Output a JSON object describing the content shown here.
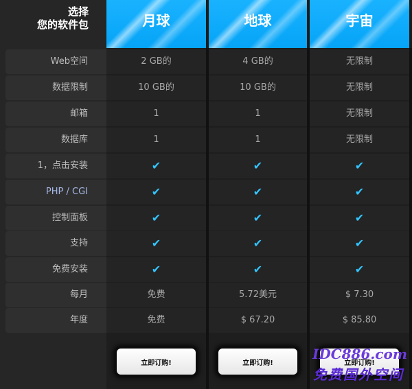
{
  "header": {
    "corner_line1": "选择",
    "corner_line2": "您的软件包",
    "plans": [
      {
        "name": "月球"
      },
      {
        "name": "地球"
      },
      {
        "name": "宇宙"
      }
    ]
  },
  "colors": {
    "header_blue": "#06a4f7",
    "check": "#33c4ff"
  },
  "rows": [
    {
      "label": "Web空间",
      "moon": "2 GB的",
      "earth": "4 GB的",
      "universe": "无限制"
    },
    {
      "label": "数据限制",
      "moon": "10 GB的",
      "earth": "10 GB的",
      "universe": "无限制"
    },
    {
      "label": "邮箱",
      "moon": "1",
      "earth": "1",
      "universe": "无限制"
    },
    {
      "label": "数据库",
      "moon": "1",
      "earth": "1",
      "universe": "无限制"
    },
    {
      "label": "1，点击安装",
      "moon": "✔",
      "earth": "✔",
      "universe": "✔"
    },
    {
      "label": "PHP / CGI",
      "moon": "✔",
      "earth": "✔",
      "universe": "✔"
    },
    {
      "label": "控制面板",
      "moon": "✔",
      "earth": "✔",
      "universe": "✔"
    },
    {
      "label": "支持",
      "moon": "✔",
      "earth": "✔",
      "universe": "✔"
    },
    {
      "label": "免费安装",
      "moon": "✔",
      "earth": "✔",
      "universe": "✔"
    },
    {
      "label": "每月",
      "moon": "免费",
      "earth": "5.72美元",
      "universe": "$ 7.30"
    },
    {
      "label": "年度",
      "moon": "免费",
      "earth": "$ 67.20",
      "universe": "$ 85.80"
    }
  ],
  "order_button_label": "立即订购!",
  "watermark": {
    "line1": "IDC886.com",
    "line2": "免费国外空间"
  }
}
